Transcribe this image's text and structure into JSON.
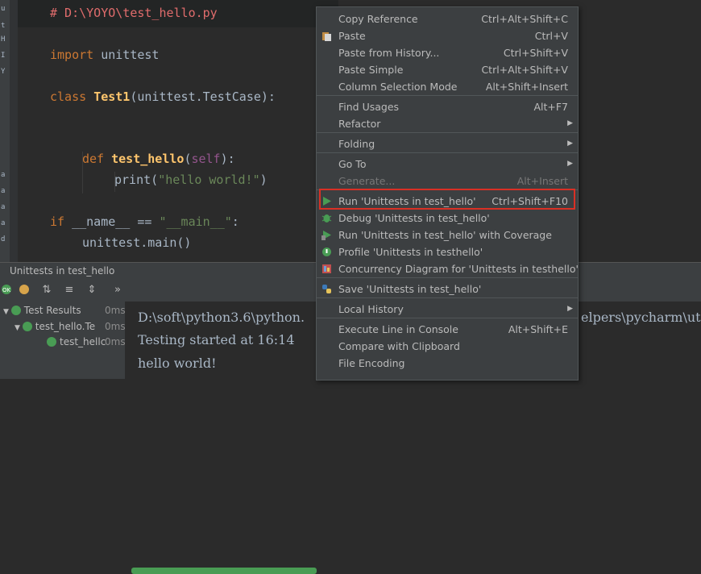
{
  "left_strip": [
    "u",
    "t",
    "H",
    "I",
    "Y",
    "",
    "a",
    "a",
    "a",
    "a",
    "d"
  ],
  "editor": {
    "lines": [
      {
        "parts": [
          {
            "t": "# D:\\YOYO\\test_hello.py",
            "c": "c-comment"
          }
        ]
      },
      {
        "parts": [
          {
            "t": "import ",
            "c": "c-kw"
          },
          {
            "t": "unittest",
            "c": "c-name"
          }
        ]
      },
      {
        "parts": [
          {
            "t": "class ",
            "c": "c-kw"
          },
          {
            "t": "Test1",
            "c": "c-fn"
          },
          {
            "t": "(unittest.TestCase):",
            "c": "c-name"
          }
        ]
      },
      {
        "parts": [
          {
            "t": "def ",
            "c": "c-kw"
          },
          {
            "t": "test_hello",
            "c": "c-fn"
          },
          {
            "t": "(",
            "c": "c-name"
          },
          {
            "t": "self",
            "c": "c-self"
          },
          {
            "t": "):",
            "c": "c-name"
          }
        ]
      },
      {
        "parts": [
          {
            "t": "print(",
            "c": "c-name"
          },
          {
            "t": "\"hello world!\"",
            "c": "c-str"
          },
          {
            "t": ")",
            "c": "c-name"
          }
        ]
      },
      {
        "parts": [
          {
            "t": "if ",
            "c": "c-kw"
          },
          {
            "t": "__name__ == ",
            "c": "c-name"
          },
          {
            "t": "\"__main__\"",
            "c": "c-str"
          },
          {
            "t": ":",
            "c": "c-name"
          }
        ]
      },
      {
        "parts": [
          {
            "t": "unittest.main()",
            "c": "c-name"
          }
        ]
      }
    ]
  },
  "run": {
    "title": "Unittests in test_hello",
    "toolbar_more": "»",
    "tree": [
      {
        "label": "Test Results",
        "time": "0ms"
      },
      {
        "label": "test_hello.Te",
        "time": "0ms"
      },
      {
        "label": "test_hellc",
        "time": "0ms"
      }
    ],
    "console": [
      "D:\\soft\\python3.6\\python.",
      "Testing started at 16:14",
      "hello world!"
    ],
    "console_tail": "elpers\\pycharm\\ut"
  },
  "menu": {
    "items": [
      {
        "label": "Copy Reference",
        "shortcut": "Ctrl+Alt+Shift+C"
      },
      {
        "label": "Paste",
        "shortcut": "Ctrl+V",
        "icon": "paste-icon"
      },
      {
        "label": "Paste from History...",
        "shortcut": "Ctrl+Shift+V"
      },
      {
        "label": "Paste Simple",
        "shortcut": "Ctrl+Alt+Shift+V"
      },
      {
        "label": "Column Selection Mode",
        "shortcut": "Alt+Shift+Insert"
      },
      {
        "label": "Find Usages",
        "shortcut": "Alt+F7"
      },
      {
        "label": "Refactor",
        "submenu": true
      },
      {
        "label": "Folding",
        "submenu": true
      },
      {
        "label": "Go To",
        "submenu": true
      },
      {
        "label": "Generate...",
        "shortcut": "Alt+Insert",
        "disabled": true
      },
      {
        "label": "Run 'Unittests in test_hello'",
        "shortcut": "Ctrl+Shift+F10",
        "icon": "run-icon"
      },
      {
        "label": "Debug 'Unittests in test_hello'",
        "icon": "debug-icon"
      },
      {
        "label": "Run 'Unittests in test_hello' with Coverage",
        "icon": "coverage-icon"
      },
      {
        "label": "Profile 'Unittests in testhello'",
        "icon": "profile-icon"
      },
      {
        "label": "Concurrency Diagram for  'Unittests in testhello'",
        "icon": "concurrency-icon"
      },
      {
        "label": "Save 'Unittests in test_hello'",
        "icon": "python-icon"
      },
      {
        "label": "Local History",
        "submenu": true
      },
      {
        "label": "Execute Line in Console",
        "shortcut": "Alt+Shift+E"
      },
      {
        "label": "Compare with Clipboard"
      },
      {
        "label": "File Encoding"
      }
    ]
  },
  "colors": {
    "highlight_border": "#d93025",
    "accent_green": "#499c54",
    "menu_bg": "#3c3f41"
  }
}
